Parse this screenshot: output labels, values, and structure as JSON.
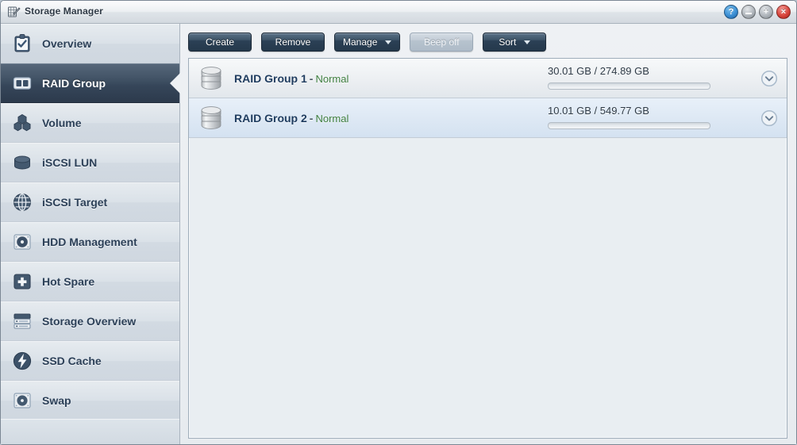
{
  "window": {
    "title": "Storage Manager",
    "app_icon": "storage-manager-icon",
    "buttons": [
      {
        "name": "help-button",
        "glyph": "?",
        "color": "#3c8fd4"
      },
      {
        "name": "minimize-button",
        "glyph": "",
        "color": "#b0b6bc"
      },
      {
        "name": "maximize-button",
        "glyph": "+",
        "color": "#b0b6bc"
      },
      {
        "name": "close-button",
        "glyph": "×",
        "color": "#d8453c"
      }
    ]
  },
  "sidebar": {
    "items": [
      {
        "label": "Overview",
        "icon": "clipboard-check-icon",
        "selected": false
      },
      {
        "label": "RAID Group",
        "icon": "raid-group-icon",
        "selected": true
      },
      {
        "label": "Volume",
        "icon": "volume-hexagons-icon",
        "selected": false
      },
      {
        "label": "iSCSI LUN",
        "icon": "lun-cylinder-icon",
        "selected": false
      },
      {
        "label": "iSCSI Target",
        "icon": "globe-icon",
        "selected": false
      },
      {
        "label": "HDD Management",
        "icon": "hard-disk-icon",
        "selected": false
      },
      {
        "label": "Hot Spare",
        "icon": "plus-square-icon",
        "selected": false
      },
      {
        "label": "Storage Overview",
        "icon": "server-rack-icon",
        "selected": false
      },
      {
        "label": "SSD Cache",
        "icon": "lightning-bolt-icon",
        "selected": false
      },
      {
        "label": "Swap",
        "icon": "swap-disk-icon",
        "selected": false
      }
    ]
  },
  "toolbar": {
    "buttons": [
      {
        "label": "Create",
        "name": "create-button",
        "caret": false,
        "disabled": false
      },
      {
        "label": "Remove",
        "name": "remove-button",
        "caret": false,
        "disabled": false
      },
      {
        "label": "Manage",
        "name": "manage-button",
        "caret": true,
        "disabled": false
      },
      {
        "label": "Beep off",
        "name": "beep-off-button",
        "caret": false,
        "disabled": true
      },
      {
        "label": "Sort",
        "name": "sort-button",
        "caret": true,
        "disabled": false
      }
    ]
  },
  "raid_groups": [
    {
      "name": "RAID Group 1",
      "separator": "-",
      "status": "Normal",
      "status_color": "#3f7f3f",
      "used": "30.01 GB",
      "total": "274.89 GB",
      "capacity_text": "30.01 GB / 274.89 GB",
      "usage_percent": 11,
      "expand_icon": "chevron-down-circle-icon"
    },
    {
      "name": "RAID Group 2",
      "separator": "-",
      "status": "Normal",
      "status_color": "#3f7f3f",
      "used": "10.01 GB",
      "total": "549.77 GB",
      "capacity_text": "10.01 GB / 549.77 GB",
      "usage_percent": 2,
      "expand_icon": "chevron-down-circle-icon"
    }
  ],
  "colors": {
    "accent": "#2f6ba5",
    "selected_nav": "#36465a",
    "panel_bg": "#e9eef2",
    "status_ok": "#3f7f3f"
  }
}
